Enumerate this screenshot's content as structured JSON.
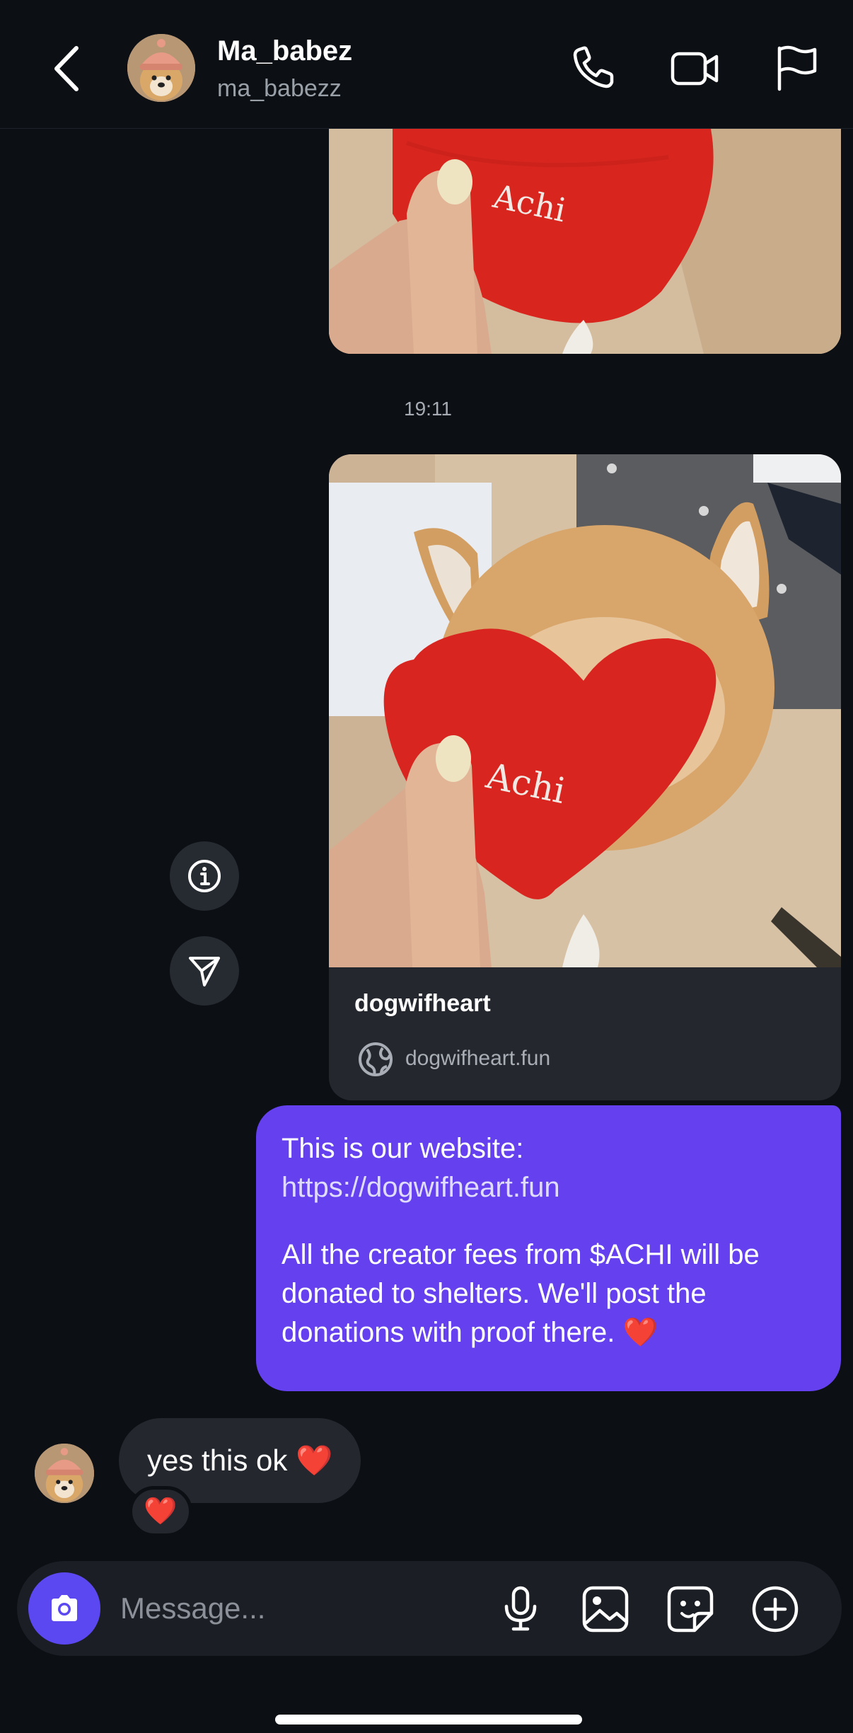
{
  "header": {
    "title": "Ma_babez",
    "subtitle": "ma_babezz",
    "icons": [
      "back-chevron-icon",
      "phone-icon",
      "video-camera-icon",
      "flag-icon"
    ]
  },
  "conversation": {
    "timestamp": "19:11",
    "link_card": {
      "title": "dogwifheart",
      "domain": "dogwifheart.fun"
    },
    "outgoing_message": {
      "line1": "This is our website:",
      "url": "https://dogwifheart.fun",
      "line3": "All the creator fees from $ACHI will be",
      "line4": "donated to shelters. We'll post the",
      "line5": "donations with proof there. ❤️"
    },
    "incoming_message": {
      "text": "yes this ok ❤️",
      "reaction": "❤️"
    },
    "photo_heart_text": "Achi"
  },
  "composer": {
    "placeholder": "Message...",
    "icons": [
      "camera-icon",
      "microphone-icon",
      "gallery-icon",
      "sticker-icon",
      "plus-circle-icon"
    ]
  },
  "colors": {
    "background": "#0c0f14",
    "outgoing_bubble": "#6440ee",
    "incoming_bubble": "#24272d",
    "camera_button": "#5b48f0"
  }
}
